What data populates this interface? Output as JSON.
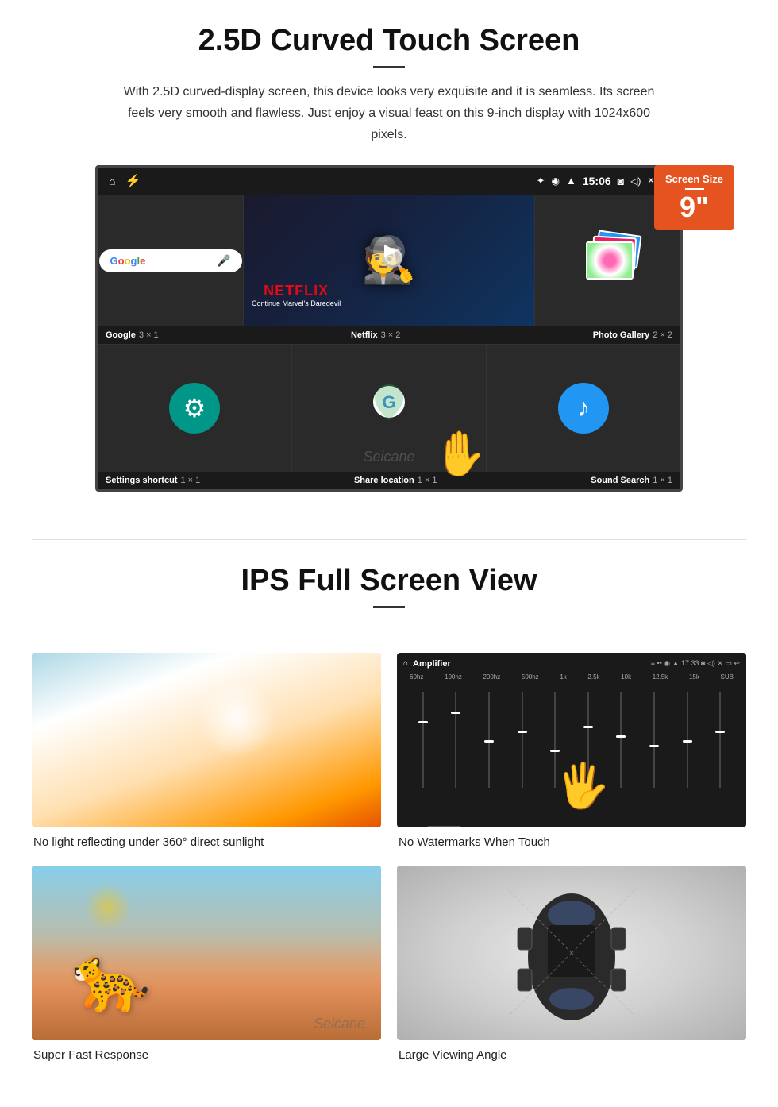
{
  "section1": {
    "title": "2.5D Curved Touch Screen",
    "description": "With 2.5D curved-display screen, this device looks very exquisite and it is seamless. Its screen feels very smooth and flawless. Just enjoy a visual feast on this 9-inch display with 1024x600 pixels.",
    "screen_badge": {
      "label": "Screen Size",
      "size": "9\""
    },
    "status_bar": {
      "time": "15:06"
    },
    "apps": {
      "row1_labels": [
        {
          "name": "Google",
          "size": "3 × 1"
        },
        {
          "name": "Netflix",
          "size": "3 × 2"
        },
        {
          "name": "Photo Gallery",
          "size": "2 × 2"
        }
      ],
      "row2_labels": [
        {
          "name": "Settings shortcut",
          "size": "1 × 1"
        },
        {
          "name": "Share location",
          "size": "1 × 1"
        },
        {
          "name": "Sound Search",
          "size": "1 × 1"
        }
      ],
      "netflix": {
        "title": "NETFLIX",
        "subtitle": "Continue Marvel's Daredevil"
      },
      "google_placeholder": "Google"
    }
  },
  "section2": {
    "title": "IPS Full Screen View",
    "features": [
      {
        "id": "sunlight",
        "label": "No light reflecting under 360° direct sunlight"
      },
      {
        "id": "watermark",
        "label": "No Watermarks When Touch"
      },
      {
        "id": "cheetah",
        "label": "Super Fast Response"
      },
      {
        "id": "car",
        "label": "Large Viewing Angle"
      }
    ]
  },
  "seicane_brand": "Seicane",
  "icons": {
    "home": "⌂",
    "usb": "⚡",
    "bluetooth": "✦",
    "location": "◉",
    "wifi": "▲",
    "camera": "◙",
    "volume": "◁)",
    "close": "✕",
    "minimize": "▭",
    "mic": "🎤",
    "gear": "⚙",
    "music": "♪",
    "play": "▶"
  }
}
